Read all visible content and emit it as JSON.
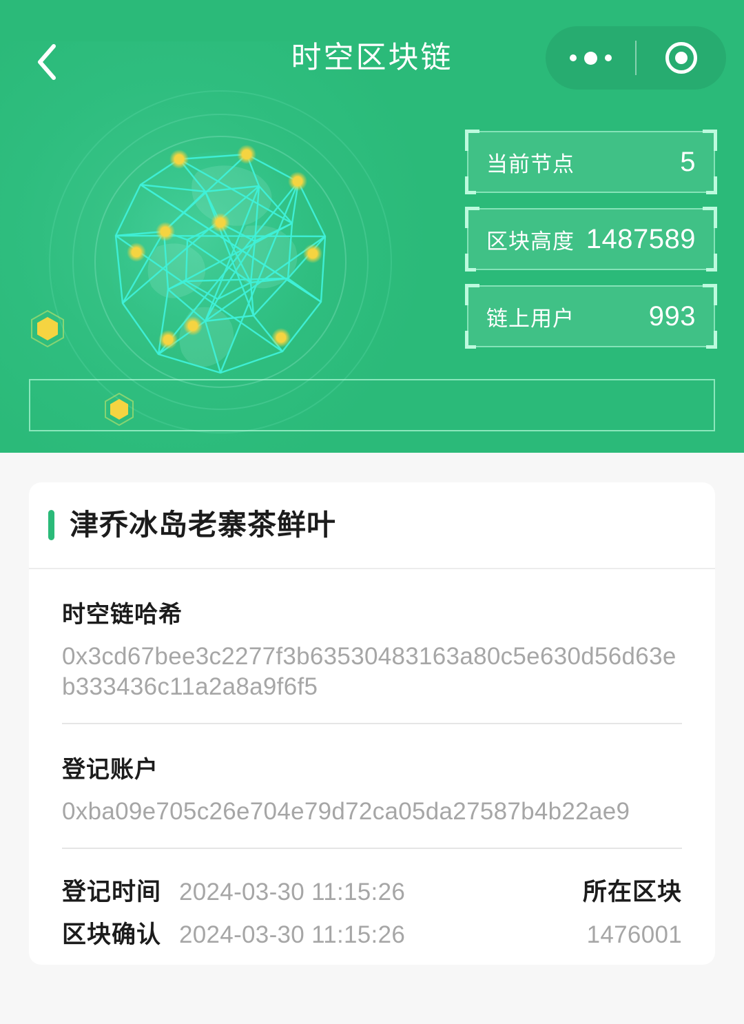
{
  "nav": {
    "title": "时空区块链",
    "back_icon": "chevron-left-icon",
    "menu_icon": "more-dots-icon",
    "close_icon": "target-circle-icon"
  },
  "hero": {
    "background_color": "#2bba79",
    "accent_color": "#bdfade",
    "node_color": "#f5d441",
    "wireframe_color": "#3ff0d8",
    "stats": [
      {
        "label": "当前节点",
        "value": "5"
      },
      {
        "label": "区块高度",
        "value": "1487589"
      },
      {
        "label": "链上用户",
        "value": "993"
      }
    ]
  },
  "info_card": {
    "title": "津乔冰岛老寨茶鲜叶",
    "title_accent_color": "#2bba79",
    "fields": [
      {
        "label": "时空链哈希",
        "value": "0x3cd67bee3c2277f3b63530483163a80c5e630d56d63eb333436c11a2a8a9f6f5"
      },
      {
        "label": "登记账户",
        "value": "0xba09e705c26e704e79d72ca05da27587b4b22ae9"
      }
    ],
    "meta": {
      "row1": {
        "key": "登记时间",
        "value": "2024-03-30 11:15:26",
        "right_key": "所在区块",
        "right_value": ""
      },
      "row2": {
        "key": "区块确认",
        "value": "2024-03-30 11:15:26",
        "right_key": "",
        "right_value": "1476001"
      }
    }
  }
}
